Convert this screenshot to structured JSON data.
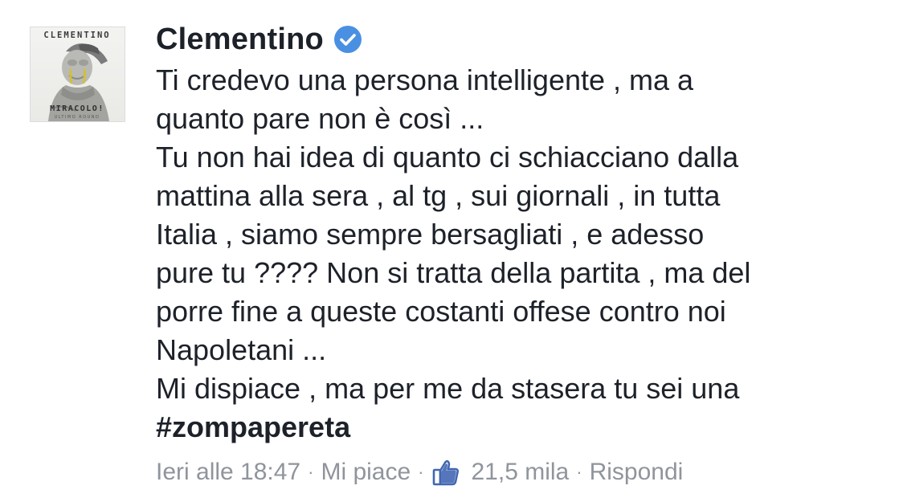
{
  "author": {
    "name": "Clementino",
    "verified": true,
    "avatar_title": "CLEMENTINO",
    "avatar_subtitle": "MIRACOLO!",
    "avatar_caption": "ULTIMO ROUND"
  },
  "comment": {
    "lines": [
      "Ti credevo una persona intelligente , ma a",
      "quanto pare non è così ...",
      "Tu non hai idea di quanto ci schiacciano dalla",
      "mattina alla sera , al tg , sui giornali , in tutta",
      "Italia , siamo sempre bersagliati , e adesso",
      "pure tu ???? Non si tratta della partita , ma del",
      "porre fine a queste costanti offese contro noi",
      "Napoletani ...",
      "Mi dispiace , ma per me da stasera tu sei una"
    ],
    "hashtag": "#zompapereta"
  },
  "meta": {
    "timestamp": "Ieri alle 18:47",
    "like_label": "Mi piace",
    "like_count": "21,5 mila",
    "reply_label": "Rispondi",
    "separator": "·"
  },
  "colors": {
    "text": "#1d2129",
    "meta": "#90949c",
    "verified_blue": "#4a90e2",
    "like_blue": "#4267b2"
  },
  "icons": {
    "verified": "verified-badge-icon",
    "like": "thumbs-up-icon"
  }
}
